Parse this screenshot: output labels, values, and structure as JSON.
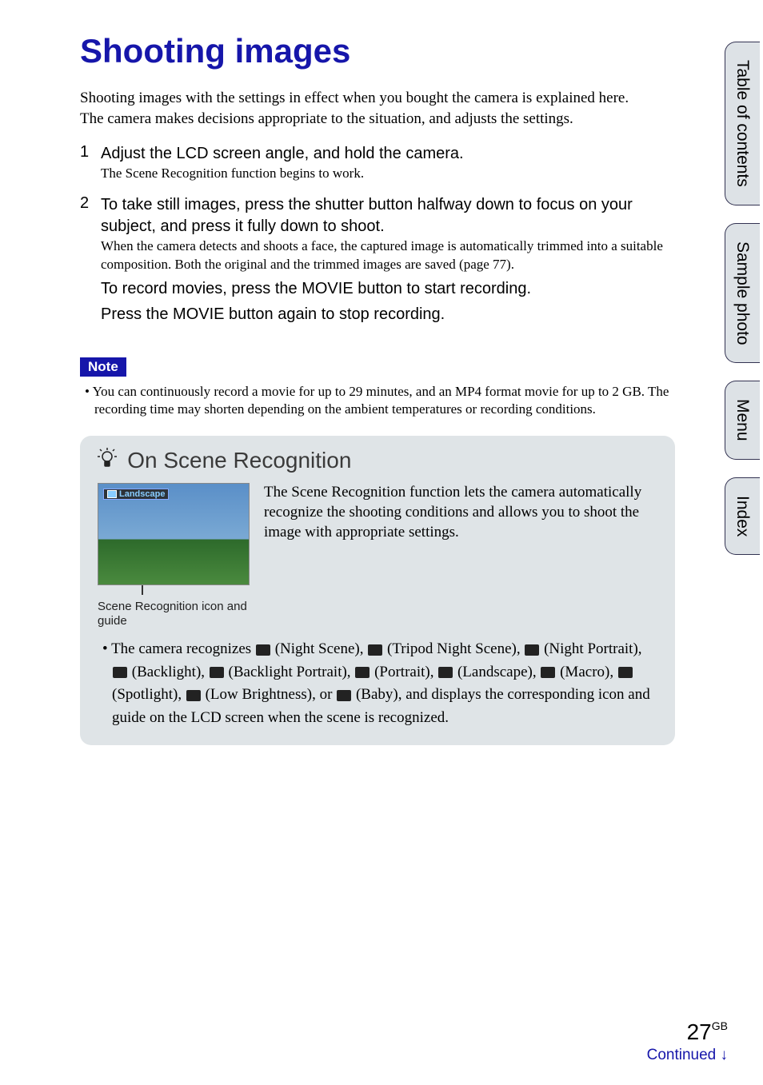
{
  "title": "Shooting images",
  "intro_p1": "Shooting images with the settings in effect when you bought the camera is explained here.",
  "intro_p2": "The camera makes decisions appropriate to the situation, and adjusts the settings.",
  "steps": [
    {
      "num": "1",
      "head": "Adjust the LCD screen angle, and hold the camera.",
      "sub": "The Scene Recognition function begins to work."
    },
    {
      "num": "2",
      "head": "To take still images, press the shutter button halfway down to focus on your subject, and press it fully down to shoot.",
      "sub": "When the camera detects and shoots a face, the captured image is automatically trimmed into a suitable composition. Both the original and the trimmed images are saved (page 77).",
      "body2a": "To record movies, press the MOVIE button to start recording.",
      "body2b": "Press the MOVIE button again to stop recording."
    }
  ],
  "note": {
    "label": "Note",
    "items": [
      "You can continuously record a movie for up to 29 minutes, and an MP4 format movie for up to 2 GB. The recording time may shorten depending on the ambient temperatures or recording conditions."
    ]
  },
  "tip": {
    "title": "On Scene Recognition",
    "img_label": "Landscape",
    "caption": "Scene Recognition icon and guide",
    "desc": "The Scene Recognition function lets the camera automatically recognize the shooting conditions and allows you to shoot the image with appropriate settings.",
    "scenes": [
      {
        "label": "Night Scene"
      },
      {
        "label": "Tripod Night Scene"
      },
      {
        "label": "Night Portrait"
      },
      {
        "label": "Backlight"
      },
      {
        "label": "Backlight Portrait"
      },
      {
        "label": "Portrait"
      },
      {
        "label": "Landscape"
      },
      {
        "label": "Macro"
      },
      {
        "label": "Spotlight"
      },
      {
        "label": "Low Brightness"
      },
      {
        "label": "Baby"
      }
    ],
    "list_prefix": "The camera recognizes ",
    "list_suffix": ", and displays the corresponding icon and guide on the LCD screen when the scene is recognized.",
    "list_or": "or "
  },
  "tabs": [
    {
      "label": "Table of contents"
    },
    {
      "label": "Sample photo"
    },
    {
      "label": "Menu"
    },
    {
      "label": "Index"
    }
  ],
  "footer": {
    "page": "27",
    "region": "GB",
    "continued": "Continued ↓"
  }
}
